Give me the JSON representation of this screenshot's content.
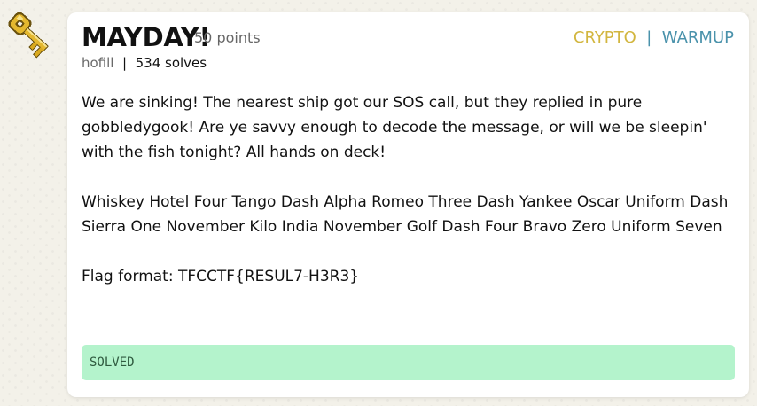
{
  "challenge": {
    "title": "MAYDAY!",
    "points": "50 points",
    "categories": [
      {
        "label": "CRYPTO",
        "color": "#d2b63f"
      },
      {
        "label": "WARMUP",
        "color": "#4a92ab"
      }
    ],
    "category_separator": "|",
    "author": "hofill",
    "meta_separator": "|",
    "solves": "534 solves",
    "description": [
      "We are sinking! The nearest ship got our SOS call, but they replied in pure gobbledygook! Are ye savvy enough to decode the message, or will we be sleepin' with the fish tonight? All hands on deck!",
      "Whiskey Hotel Four Tango Dash Alpha Romeo Three Dash Yankee Oscar Uniform Dash Sierra One November Kilo India November Golf Dash Four Bravo Zero Uniform Seven",
      "Flag format: TFCCTF{RESUL7-H3R3}"
    ],
    "status": "SOLVED",
    "status_color": "#b4f3cc"
  },
  "icons": {
    "challenge_icon": "golden-key-icon"
  }
}
